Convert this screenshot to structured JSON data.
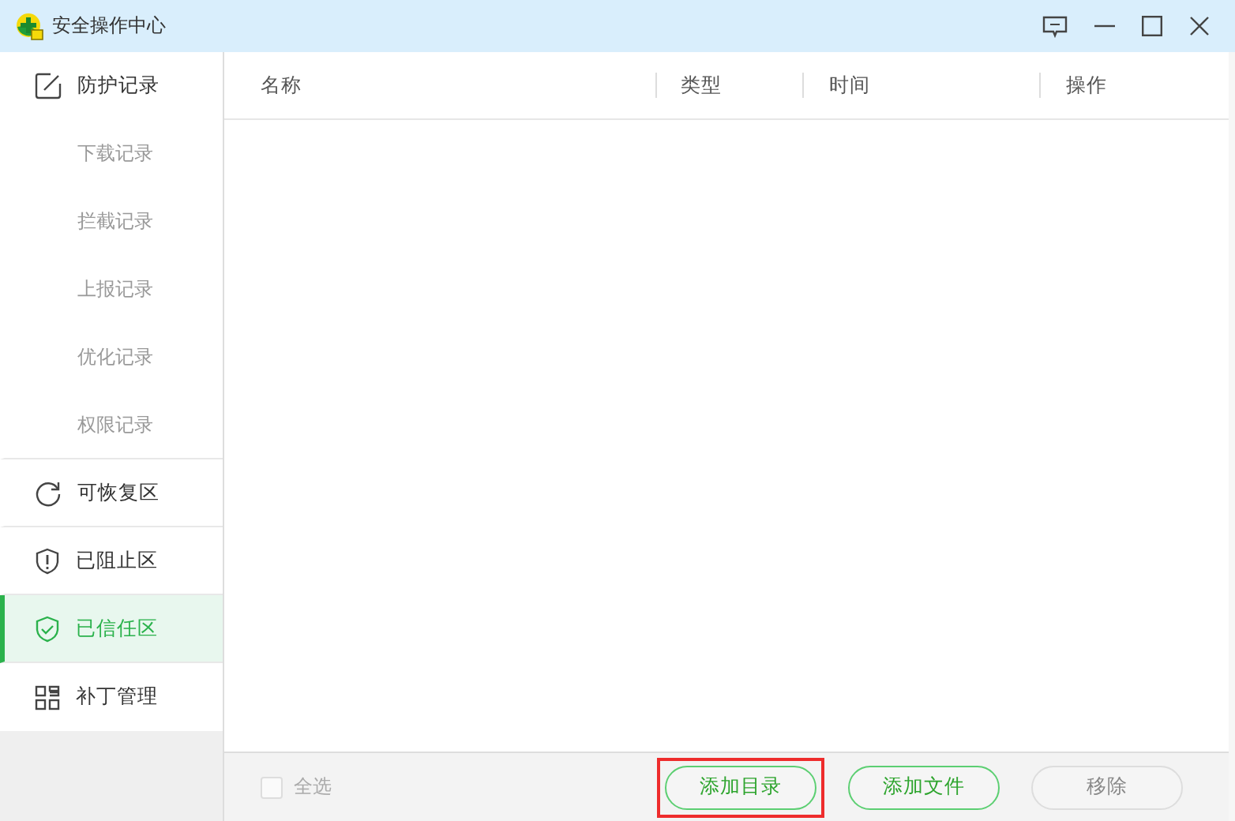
{
  "window": {
    "title": "安全操作中心"
  },
  "sidebar": {
    "items": [
      {
        "kind": "group",
        "label": "防护记录",
        "selected": false
      },
      {
        "kind": "sub",
        "label": "下载记录",
        "selected": false
      },
      {
        "kind": "sub",
        "label": "拦截记录",
        "selected": false
      },
      {
        "kind": "sub",
        "label": "上报记录",
        "selected": false
      },
      {
        "kind": "sub",
        "label": "优化记录",
        "selected": false
      },
      {
        "kind": "sub",
        "label": "权限记录",
        "selected": false
      },
      {
        "kind": "group",
        "label": "可恢复区",
        "selected": false
      },
      {
        "kind": "group",
        "label": "已阻止区",
        "selected": false
      },
      {
        "kind": "group",
        "label": "已信任区",
        "selected": true
      },
      {
        "kind": "group",
        "label": "补丁管理",
        "selected": false
      }
    ]
  },
  "table": {
    "columns": [
      "名称",
      "类型",
      "时间",
      "操作"
    ]
  },
  "footer": {
    "select_all": {
      "label": "全选",
      "checked": false,
      "disabled": true
    },
    "buttons": [
      {
        "label": "添加目录",
        "disabled": false,
        "highlighted": true
      },
      {
        "label": "添加文件",
        "disabled": false,
        "highlighted": false
      },
      {
        "label": "移除",
        "disabled": true,
        "highlighted": false
      }
    ]
  }
}
